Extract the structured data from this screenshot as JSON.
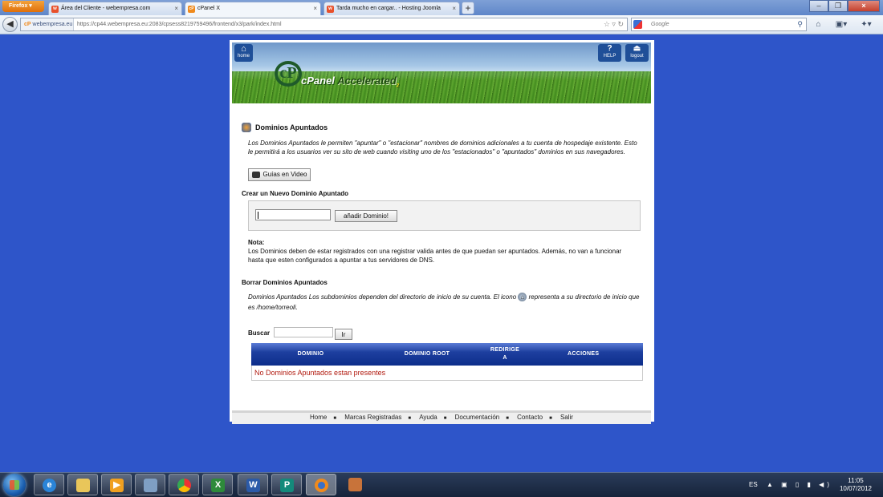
{
  "browser": {
    "menu_button": "Firefox",
    "tabs": [
      {
        "label": "Área del Cliente - webempresa.com",
        "icon_text": "w",
        "icon_color": "#e8502a",
        "active": false
      },
      {
        "label": "cPanel X",
        "icon_text": "cP",
        "icon_color": "#f08a1c",
        "active": true
      },
      {
        "label": "Tarda mucho en cargar.. - Hosting Joomla",
        "icon_text": "w",
        "icon_color": "#e8502a",
        "active": false
      }
    ],
    "new_tab": "+",
    "site_identity": "webempresa.eu",
    "url": "https://cp44.webempresa.eu:2083/cpsess82197594​96/frontend/x3/park/index.html",
    "search_placeholder": "Google"
  },
  "banner": {
    "home_label": "home",
    "help_label": "HELP",
    "logout_label": "logout",
    "logo_mark": "cP",
    "logo_text": "cPanel",
    "logo_accent": "Accelerated",
    "logo_sub": "2"
  },
  "content": {
    "title": "Dominios Apuntados",
    "description": "Los Dominios Apuntados le permiten \"apuntar\" o \"estacionar\" nombres de dominios adicionales a tu cuenta de hospedaje existente. Esto le permitirá a los usuarios ver su sito de web cuando visiting uno de los \"estacionados\" o \"apuntados\" dominios en sus navegadores.",
    "video_button": "Guías en Video",
    "create_heading": "Crear un Nuevo Dominio Apuntado",
    "domain_input_value": "",
    "add_button": "añadir Dominio!",
    "note_label": "Nota:",
    "note_text": "Los Dominios deben de estar registrados con una registrar valida antes de que puedan ser apuntados. Además, no van a funcionar hasta que esten configurados a apuntar a tus servidores de DNS.",
    "delete_heading": "Borrar Dominios Apuntados",
    "delete_desc_1": "Dominios Apuntados Los subdominios dependen del directorio de inicio de su cuenta. El icono",
    "delete_desc_2": "representa a su directorio de inicio que es /home/torreoli.",
    "search_label": "Buscar",
    "search_value": "",
    "search_button": "Ir",
    "table": {
      "columns": [
        "Dominio",
        "Dominio Root",
        "Redirige a",
        "Acciones"
      ],
      "empty_message": "No Dominios Apuntados estan presentes"
    }
  },
  "footer": {
    "links": [
      "Home",
      "Marcas Registradas",
      "Ayuda",
      "Documentación",
      "Contacto",
      "Salir"
    ]
  },
  "taskbar": {
    "language": "ES",
    "time": "11:05",
    "date": "10/07/2012"
  }
}
